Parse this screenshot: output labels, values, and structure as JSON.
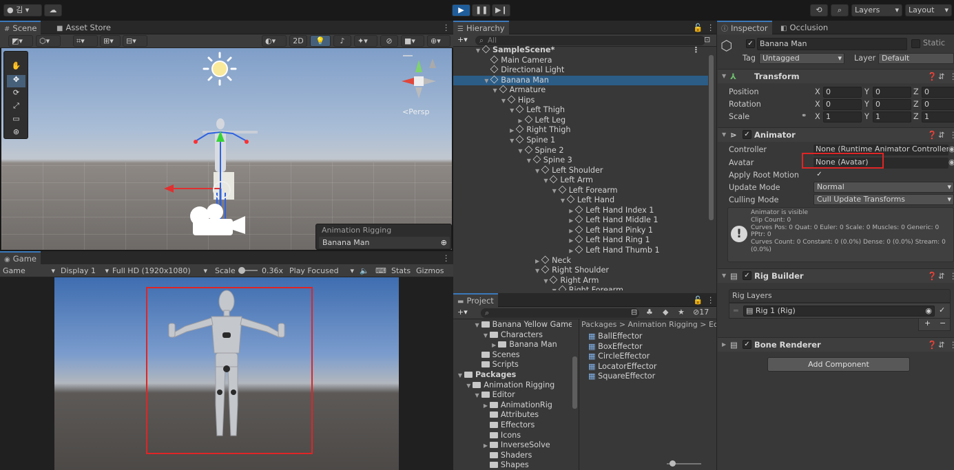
{
  "toolbar": {
    "account": "김",
    "layers": "Layers",
    "layout": "Layout"
  },
  "scene_panel": {
    "tabs": [
      "Scene",
      "Asset Store"
    ],
    "mode_2d": "2D",
    "persp": "<Persp",
    "overlay_title": "Animation Rigging",
    "overlay_value": "Banana Man"
  },
  "game_panel": {
    "tab": "Game",
    "mode": "Game",
    "display": "Display 1",
    "resolution": "Full HD (1920x1080)",
    "scale_label": "Scale",
    "scale_value": "0.36x",
    "play_focused": "Play Focused",
    "stats": "Stats",
    "gizmos": "Gizmos"
  },
  "hierarchy": {
    "tab": "Hierarchy",
    "search_placeholder": "All",
    "items": [
      {
        "label": "SampleScene*",
        "depth": 0,
        "arrow": "▼",
        "bold": true
      },
      {
        "label": "Main Camera",
        "depth": 1,
        "arrow": ""
      },
      {
        "label": "Directional Light",
        "depth": 1,
        "arrow": ""
      },
      {
        "label": "Banana Man",
        "depth": 1,
        "arrow": "▼",
        "selected": true
      },
      {
        "label": "Armature",
        "depth": 2,
        "arrow": "▼"
      },
      {
        "label": "Hips",
        "depth": 3,
        "arrow": "▼"
      },
      {
        "label": "Left Thigh",
        "depth": 4,
        "arrow": "▼"
      },
      {
        "label": "Left Leg",
        "depth": 5,
        "arrow": "▶"
      },
      {
        "label": "Right Thigh",
        "depth": 4,
        "arrow": "▶"
      },
      {
        "label": "Spine 1",
        "depth": 4,
        "arrow": "▼"
      },
      {
        "label": "Spine 2",
        "depth": 5,
        "arrow": "▼"
      },
      {
        "label": "Spine 3",
        "depth": 6,
        "arrow": "▼"
      },
      {
        "label": "Left Shoulder",
        "depth": 7,
        "arrow": "▼"
      },
      {
        "label": "Left Arm",
        "depth": 8,
        "arrow": "▼"
      },
      {
        "label": "Left Forearm",
        "depth": 9,
        "arrow": "▼"
      },
      {
        "label": "Left Hand",
        "depth": 10,
        "arrow": "▼"
      },
      {
        "label": "Left Hand Index 1",
        "depth": 11,
        "arrow": "▶"
      },
      {
        "label": "Left Hand Middle 1",
        "depth": 11,
        "arrow": "▶"
      },
      {
        "label": "Left Hand Pinky 1",
        "depth": 11,
        "arrow": "▶"
      },
      {
        "label": "Left Hand Ring 1",
        "depth": 11,
        "arrow": "▶"
      },
      {
        "label": "Left Hand Thumb 1",
        "depth": 11,
        "arrow": "▶"
      },
      {
        "label": "Neck",
        "depth": 7,
        "arrow": "▶"
      },
      {
        "label": "Right Shoulder",
        "depth": 7,
        "arrow": "▼"
      },
      {
        "label": "Right Arm",
        "depth": 8,
        "arrow": "▼"
      },
      {
        "label": "Right Forearm",
        "depth": 9,
        "arrow": "▼"
      }
    ]
  },
  "project": {
    "tab": "Project",
    "hidden_count": "17",
    "tree": [
      {
        "label": "Banana Yellow Game",
        "depth": 2,
        "arrow": "▼"
      },
      {
        "label": "Characters",
        "depth": 3,
        "arrow": "▼"
      },
      {
        "label": "Banana Man",
        "depth": 4,
        "arrow": "▶"
      },
      {
        "label": "Scenes",
        "depth": 2,
        "arrow": ""
      },
      {
        "label": "Scripts",
        "depth": 2,
        "arrow": ""
      },
      {
        "label": "Packages",
        "depth": 0,
        "arrow": "▼",
        "bold": true
      },
      {
        "label": "Animation Rigging",
        "depth": 1,
        "arrow": "▼"
      },
      {
        "label": "Editor",
        "depth": 2,
        "arrow": "▼"
      },
      {
        "label": "AnimationRig",
        "depth": 3,
        "arrow": "▶"
      },
      {
        "label": "Attributes",
        "depth": 3,
        "arrow": ""
      },
      {
        "label": "Effectors",
        "depth": 3,
        "arrow": ""
      },
      {
        "label": "Icons",
        "depth": 3,
        "arrow": ""
      },
      {
        "label": "InverseSolve",
        "depth": 3,
        "arrow": "▶"
      },
      {
        "label": "Shaders",
        "depth": 3,
        "arrow": ""
      },
      {
        "label": "Shapes",
        "depth": 3,
        "arrow": ""
      }
    ],
    "breadcrumb": "Packages > Animation Rigging > Edi",
    "assets": [
      "BallEffector",
      "BoxEffector",
      "CircleEffector",
      "LocatorEffector",
      "SquareEffector"
    ]
  },
  "inspector": {
    "tabs": [
      "Inspector",
      "Occlusion"
    ],
    "object_name": "Banana Man",
    "static_label": "Static",
    "tag_label": "Tag",
    "tag_value": "Untagged",
    "layer_label": "Layer",
    "layer_value": "Default",
    "transform": {
      "title": "Transform",
      "rows": [
        {
          "label": "Position",
          "x": "0",
          "y": "0",
          "z": "0"
        },
        {
          "label": "Rotation",
          "x": "0",
          "y": "0",
          "z": "0"
        },
        {
          "label": "Scale",
          "x": "1",
          "y": "1",
          "z": "1"
        }
      ]
    },
    "animator": {
      "title": "Animator",
      "controller_label": "Controller",
      "controller_value": "None (Runtime Animator Controller)",
      "avatar_label": "Avatar",
      "avatar_value": "None (Avatar)",
      "apply_root_label": "Apply Root Motion",
      "update_label": "Update Mode",
      "update_value": "Normal",
      "culling_label": "Culling Mode",
      "culling_value": "Cull Update Transforms",
      "info": [
        "Animator is visible",
        "Clip Count: 0",
        "Curves Pos: 0 Quat: 0 Euler: 0 Scale: 0 Muscles: 0 Generic: 0",
        "PPtr: 0",
        "Curves Count: 0 Constant: 0 (0.0%) Dense: 0 (0.0%) Stream: 0",
        "(0.0%)"
      ]
    },
    "rig_builder": {
      "title": "Rig Builder",
      "layers_label": "Rig Layers",
      "rig_item": "Rig 1 (Rig)"
    },
    "bone_renderer": {
      "title": "Bone Renderer"
    },
    "add_component": "Add Component"
  },
  "colors": {
    "accent": "#3a79bb",
    "highlight": "#e02525",
    "selected_row": "#2c5d87"
  }
}
